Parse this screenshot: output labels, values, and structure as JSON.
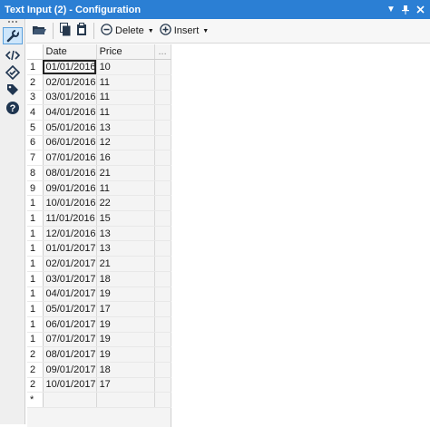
{
  "window": {
    "title": "Text Input (2) - Configuration"
  },
  "toolbar": {
    "delete_label": "Delete",
    "insert_label": "Insert"
  },
  "grid": {
    "headers": [
      "Date",
      "Price",
      "..."
    ],
    "rows": [
      {
        "idx": "1",
        "date": "01/01/2016",
        "price": "10"
      },
      {
        "idx": "2",
        "date": "02/01/2016",
        "price": "11"
      },
      {
        "idx": "3",
        "date": "03/01/2016",
        "price": "11"
      },
      {
        "idx": "4",
        "date": "04/01/2016",
        "price": "11"
      },
      {
        "idx": "5",
        "date": "05/01/2016",
        "price": "13"
      },
      {
        "idx": "6",
        "date": "06/01/2016",
        "price": "12"
      },
      {
        "idx": "7",
        "date": "07/01/2016",
        "price": "16"
      },
      {
        "idx": "8",
        "date": "08/01/2016",
        "price": "21"
      },
      {
        "idx": "9",
        "date": "09/01/2016",
        "price": "11"
      },
      {
        "idx": "1",
        "date": "10/01/2016",
        "price": "22"
      },
      {
        "idx": "1",
        "date": "11/01/2016",
        "price": "15"
      },
      {
        "idx": "1",
        "date": "12/01/2016",
        "price": "13"
      },
      {
        "idx": "1",
        "date": "01/01/2017",
        "price": "13"
      },
      {
        "idx": "1",
        "date": "02/01/2017",
        "price": "21"
      },
      {
        "idx": "1",
        "date": "03/01/2017",
        "price": "18"
      },
      {
        "idx": "1",
        "date": "04/01/2017",
        "price": "19"
      },
      {
        "idx": "1",
        "date": "05/01/2017",
        "price": "17"
      },
      {
        "idx": "1",
        "date": "06/01/2017",
        "price": "19"
      },
      {
        "idx": "1",
        "date": "07/01/2017",
        "price": "19"
      },
      {
        "idx": "2",
        "date": "08/01/2017",
        "price": "19"
      },
      {
        "idx": "2",
        "date": "09/01/2017",
        "price": "18"
      },
      {
        "idx": "2",
        "date": "10/01/2017",
        "price": "17"
      }
    ],
    "new_row_marker": "*"
  },
  "icons": {
    "rail": [
      "wrench-icon",
      "code-icon",
      "check-badge-icon",
      "tag-icon",
      "help-icon"
    ],
    "toolbar": [
      "open-folder-icon",
      "copy-icon",
      "paste-icon",
      "delete-minus-icon",
      "insert-plus-icon"
    ]
  },
  "colors": {
    "titlebar": "#2b7fd4",
    "rail_active": "#cde6fb"
  }
}
